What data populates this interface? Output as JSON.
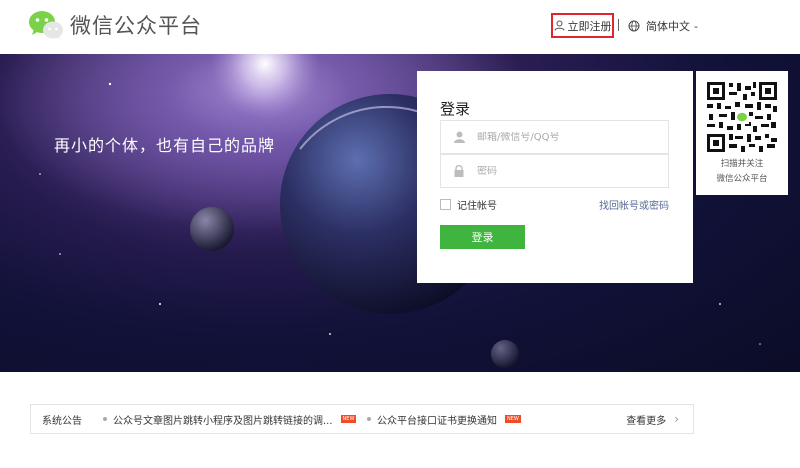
{
  "header": {
    "app_title": "微信公众平台",
    "register_label": "立即注册",
    "language_label": "简体中文",
    "language_caret": "-"
  },
  "banner": {
    "slogan": "再小的个体，也有自己的品牌"
  },
  "login": {
    "title": "登录",
    "account_placeholder": "邮箱/微信号/QQ号",
    "account_value": "",
    "password_placeholder": "密码",
    "password_value": "",
    "remember_label": "记住帐号",
    "remember_checked": false,
    "forgot_label": "找回帐号或密码",
    "submit_label": "登录"
  },
  "qr": {
    "line1": "扫描并关注",
    "line2": "微信公众平台"
  },
  "notice": {
    "label": "系统公告",
    "items": [
      {
        "text": "公众号文章图片跳转小程序及图片跳转链接的调...",
        "badge": "NEW"
      },
      {
        "text": "公众平台接口证书更换通知",
        "badge": "NEW"
      }
    ],
    "more_label": "查看更多",
    "more_icon": "chevron-right-icon"
  },
  "colors": {
    "brand_green": "#3fb53f",
    "register_outline": "#e0262c",
    "link_blue": "#576b95",
    "badge_red": "#f04d26"
  }
}
